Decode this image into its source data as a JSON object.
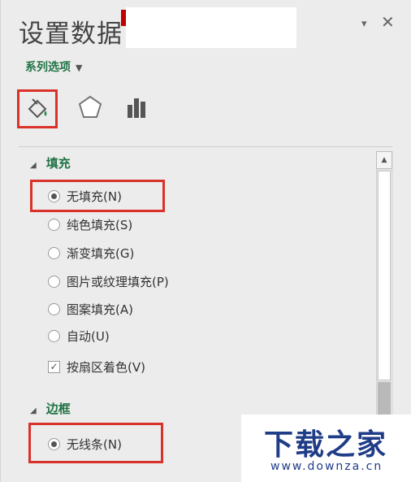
{
  "panel": {
    "title": "设置数据",
    "series_dropdown": "系列选项",
    "dropdown_arrow": "▾",
    "close": "✕"
  },
  "tabs": [
    {
      "name": "fill-line",
      "icon": "paint-bucket-icon"
    },
    {
      "name": "effects",
      "icon": "pentagon-icon"
    },
    {
      "name": "series-options",
      "icon": "bar-chart-icon"
    }
  ],
  "fill_section": {
    "title": "填充",
    "options": [
      {
        "label": "无填充(N)",
        "selected": true
      },
      {
        "label": "纯色填充(S)",
        "selected": false
      },
      {
        "label": "渐变填充(G)",
        "selected": false
      },
      {
        "label": "图片或纹理填充(P)",
        "selected": false
      },
      {
        "label": "图案填充(A)",
        "selected": false
      },
      {
        "label": "自动(U)",
        "selected": false
      }
    ],
    "vary_colors": {
      "label": "按扇区着色(V)",
      "checked": true
    }
  },
  "border_section": {
    "title": "边框",
    "options": [
      {
        "label": "无线条(N)",
        "selected": true
      }
    ]
  },
  "watermark": {
    "title": "下载之家",
    "site": "www.downza.cn"
  },
  "colors": {
    "accent_green": "#217346",
    "highlight_red": "#d9322b",
    "watermark_blue": "#1f3c88"
  }
}
